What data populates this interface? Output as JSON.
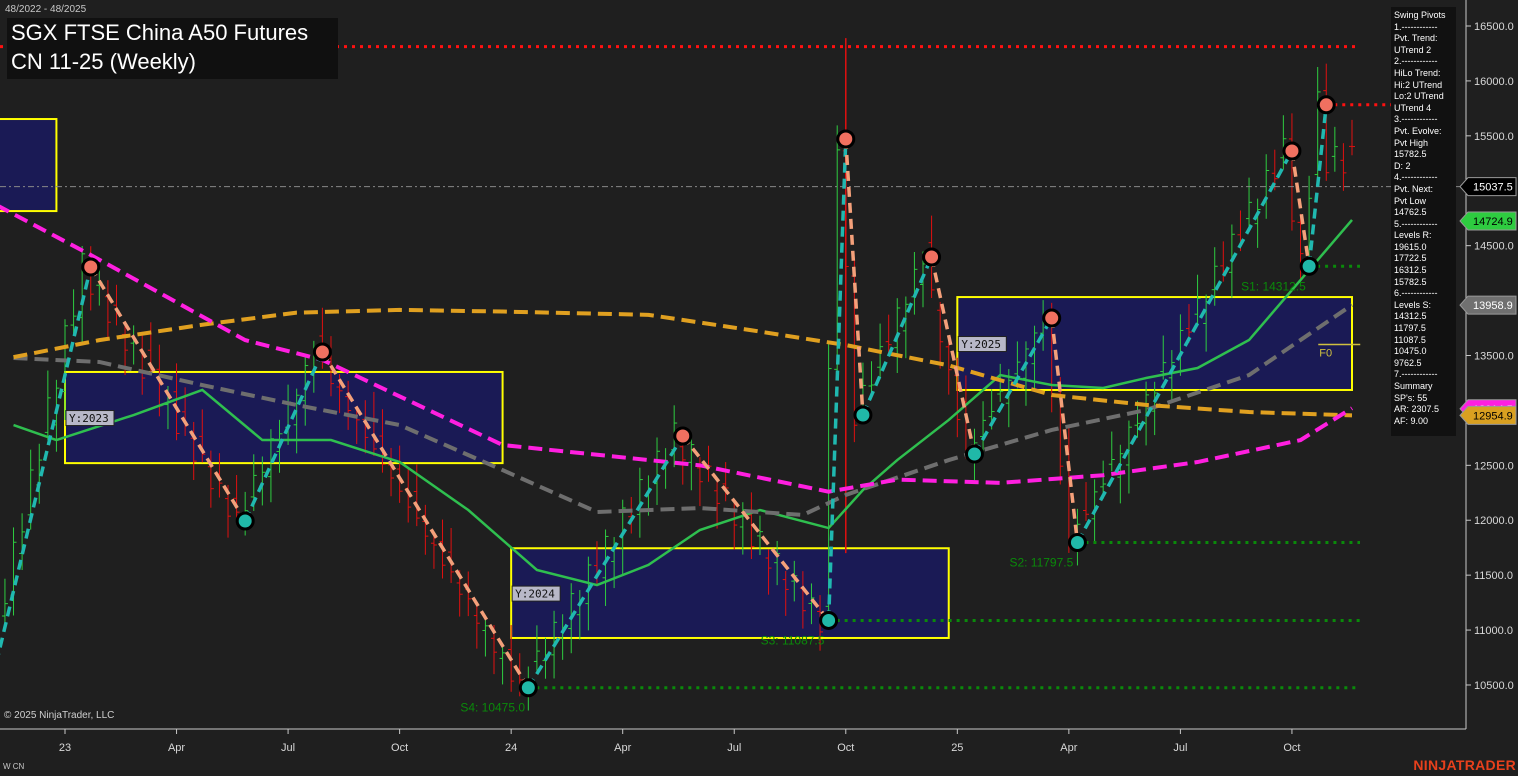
{
  "header": {
    "date_range": "48/2022 - 48/2025",
    "title_line1": "SGX FTSE China A50 Futures",
    "title_line2": "CN 11-25 (Weekly)"
  },
  "footer": {
    "copyright": "© 2025 NinjaTrader, LLC",
    "instrument_code": "W CN",
    "brand": "NINJATRADER"
  },
  "pivot_panel": {
    "lines": [
      "Swing Pivots",
      "1.------------",
      "Pvt. Trend:",
      "UTrend 2",
      "2.------------",
      "HiLo Trend:",
      "Hi:2 UTrend",
      "Lo:2 UTrend",
      "UTrend 4",
      "3.------------",
      "Pvt. Evolve:",
      "Pvt High",
      "15782.5",
      "D: 2",
      "4.------------",
      "Pvt. Next:",
      "Pvt Low",
      "14762.5",
      "5.------------",
      "Levels R:",
      "19615.0",
      "17722.5",
      "16312.5",
      "15782.5",
      "6.------------",
      "Levels S:",
      "14312.5",
      "11797.5",
      "11087.5",
      "10475.0",
      "9762.5",
      "7.------------",
      "Summary",
      "SP's: 55",
      "AR: 2307.5",
      "AF: 9.00"
    ]
  },
  "colors": {
    "background": "#1f1f1f",
    "up_bar": "#2ecc40",
    "down_bar": "#e01010",
    "ma_fast": "#2fbf4f",
    "ma_gray": "#6e6e6e",
    "ma_gold": "#e0a020",
    "ma_magenta": "#ff1fe0",
    "up_leg": "#20b8b0",
    "down_leg": "#f4a07a",
    "box_fill": "#1a1a55",
    "box_border": "#ffff00",
    "support": "#0a8a0a",
    "resistance": "#ff1010"
  },
  "chart_data": {
    "type": "candlestick",
    "title": "SGX FTSE China A50 Futures CN 11-25 (Weekly)",
    "x_unit": "weeks since first week of 2023",
    "x_range": [
      -8,
      152
    ],
    "ylim": [
      10000,
      16800
    ],
    "y_ticks": [
      10500,
      11000,
      11500,
      12000,
      12500,
      13000,
      13500,
      14000,
      14500,
      15000,
      15500,
      16000,
      16500
    ],
    "y_tick_labels": [
      "10500.0",
      "11000.0",
      "11500.0",
      "12000.0",
      "12500.0",
      "13000.0",
      "13500.0",
      "14000.0",
      "14500.0",
      "15000.0",
      "15500.0",
      "16000.0",
      "16500.0"
    ],
    "x_ticks": [
      {
        "week": 0,
        "label": "23"
      },
      {
        "week": 13,
        "label": "Apr"
      },
      {
        "week": 26,
        "label": "Jul"
      },
      {
        "week": 39,
        "label": "Oct"
      },
      {
        "week": 52,
        "label": "24"
      },
      {
        "week": 65,
        "label": "Apr"
      },
      {
        "week": 78,
        "label": "Jul"
      },
      {
        "week": 91,
        "label": "Oct"
      },
      {
        "week": 104,
        "label": "25"
      },
      {
        "week": 117,
        "label": "Apr"
      },
      {
        "week": 130,
        "label": "Jul"
      },
      {
        "week": 143,
        "label": "Oct"
      }
    ],
    "swing_pivots": [
      {
        "week": -8,
        "price": 10700,
        "type": "low"
      },
      {
        "week": 3,
        "price": 14306,
        "type": "high"
      },
      {
        "week": 21,
        "price": 11993,
        "type": "low"
      },
      {
        "week": 30,
        "price": 13532,
        "type": "high"
      },
      {
        "week": 54,
        "price": 10475,
        "type": "low"
      },
      {
        "week": 72,
        "price": 12767,
        "type": "high"
      },
      {
        "week": 89,
        "price": 11087.5,
        "type": "low"
      },
      {
        "week": 91,
        "price": 15471,
        "type": "high"
      },
      {
        "week": 93,
        "price": 12958,
        "type": "low"
      },
      {
        "week": 101,
        "price": 14397,
        "type": "high"
      },
      {
        "week": 106,
        "price": 12603,
        "type": "low"
      },
      {
        "week": 115,
        "price": 13841,
        "type": "high"
      },
      {
        "week": 118,
        "price": 11797.5,
        "type": "low"
      },
      {
        "week": 143,
        "price": 15362,
        "type": "high"
      },
      {
        "week": 145,
        "price": 14312.5,
        "type": "low"
      },
      {
        "week": 147,
        "price": 15782.5,
        "type": "high"
      }
    ],
    "moving_averages": [
      {
        "name": "fast",
        "color_key": "ma_fast",
        "dashed": false,
        "points": [
          [
            -6,
            12867
          ],
          [
            -1,
            12730
          ],
          [
            8,
            12958
          ],
          [
            16,
            13186
          ],
          [
            23,
            12730
          ],
          [
            31,
            12730
          ],
          [
            39,
            12530
          ],
          [
            47,
            12093
          ],
          [
            55,
            11547
          ],
          [
            62,
            11410
          ],
          [
            68,
            11593
          ],
          [
            74,
            11911
          ],
          [
            81,
            12093
          ],
          [
            89,
            11929
          ],
          [
            93,
            12275
          ],
          [
            97,
            12548
          ],
          [
            103,
            12913
          ],
          [
            109,
            13322
          ],
          [
            115,
            13231
          ],
          [
            121,
            13204
          ],
          [
            126,
            13295
          ],
          [
            132,
            13386
          ],
          [
            138,
            13641
          ],
          [
            144,
            14187
          ],
          [
            150,
            14734
          ]
        ]
      },
      {
        "name": "gray",
        "color_key": "ma_gray",
        "dashed": true,
        "points": [
          [
            -6,
            13477
          ],
          [
            4,
            13441
          ],
          [
            16,
            13231
          ],
          [
            27,
            13049
          ],
          [
            39,
            12867
          ],
          [
            51,
            12457
          ],
          [
            62,
            12075
          ],
          [
            74,
            12111
          ],
          [
            86,
            12048
          ],
          [
            91,
            12230
          ],
          [
            103,
            12548
          ],
          [
            115,
            12822
          ],
          [
            126,
            13004
          ],
          [
            138,
            13322
          ],
          [
            150,
            13960
          ]
        ]
      },
      {
        "name": "gold",
        "color_key": "ma_gold",
        "dashed": true,
        "points": [
          [
            -6,
            13485
          ],
          [
            4,
            13640
          ],
          [
            16,
            13780
          ],
          [
            27,
            13890
          ],
          [
            39,
            13915
          ],
          [
            51,
            13900
          ],
          [
            68,
            13870
          ],
          [
            80,
            13730
          ],
          [
            91,
            13595
          ],
          [
            103,
            13410
          ],
          [
            115,
            13140
          ],
          [
            126,
            13050
          ],
          [
            138,
            12985
          ],
          [
            150,
            12955
          ]
        ]
      },
      {
        "name": "magenta",
        "color_key": "ma_magenta",
        "dashed": true,
        "points": [
          [
            -8,
            14870
          ],
          [
            3,
            14415
          ],
          [
            21,
            13640
          ],
          [
            30,
            13460
          ],
          [
            51,
            12685
          ],
          [
            74,
            12500
          ],
          [
            89,
            12260
          ],
          [
            97,
            12370
          ],
          [
            109,
            12340
          ],
          [
            121,
            12410
          ],
          [
            132,
            12530
          ],
          [
            144,
            12730
          ],
          [
            150,
            13020
          ]
        ]
      }
    ],
    "year_boxes": [
      {
        "label": "",
        "start_week": -8,
        "end_week": -1,
        "high": 15653,
        "low": 14815
      },
      {
        "label": "Y:2023",
        "start_week": 0,
        "end_week": 51,
        "high": 13350,
        "low": 12520
      },
      {
        "label": "Y:2024",
        "start_week": 52,
        "end_week": 103,
        "high": 11745,
        "low": 10928
      },
      {
        "label": "Y:2025",
        "start_week": 104,
        "end_week": 150,
        "high": 14032,
        "low": 13186
      }
    ],
    "fib_marker": {
      "label": "F0",
      "week": 147,
      "price": 13600
    },
    "levels": [
      {
        "name": "R",
        "label": "",
        "price": 16312.5,
        "from_week": -8,
        "kind": "resistance"
      },
      {
        "name": "R1",
        "label": "",
        "price": 15782.5,
        "from_week": 147,
        "kind": "resistance"
      },
      {
        "name": "S1",
        "label": "S1: 14312.5",
        "price": 14312.5,
        "from_week": 145,
        "kind": "support"
      },
      {
        "name": "S2",
        "label": "S2: 11797.5",
        "price": 11797.5,
        "from_week": 118,
        "kind": "support"
      },
      {
        "name": "S3",
        "label": "S3: 11087.5",
        "price": 11087.5,
        "from_week": 89,
        "kind": "support"
      },
      {
        "name": "S4",
        "label": "S4: 10475.0",
        "price": 10475.0,
        "from_week": 54,
        "kind": "support"
      }
    ],
    "current_price_line": 15037.5,
    "price_badges": [
      {
        "value": "15037.5",
        "price": 15037.5,
        "bg": "#000000",
        "fg": "#ffffff"
      },
      {
        "value": "14724.9",
        "price": 14724.9,
        "bg": "#2ecc40",
        "fg": "#000000"
      },
      {
        "value": "13958.9",
        "price": 13958.9,
        "bg": "#707070",
        "fg": "#ffffff"
      },
      {
        "value": "13014.5",
        "price": 13014.5,
        "bg": "#ff1fe0",
        "fg": "#ffffff"
      },
      {
        "value": "12954.9",
        "price": 12954.9,
        "bg": "#d9a020",
        "fg": "#000000"
      }
    ],
    "spike": {
      "week": 91,
      "high": 16390,
      "low": 11700
    }
  }
}
